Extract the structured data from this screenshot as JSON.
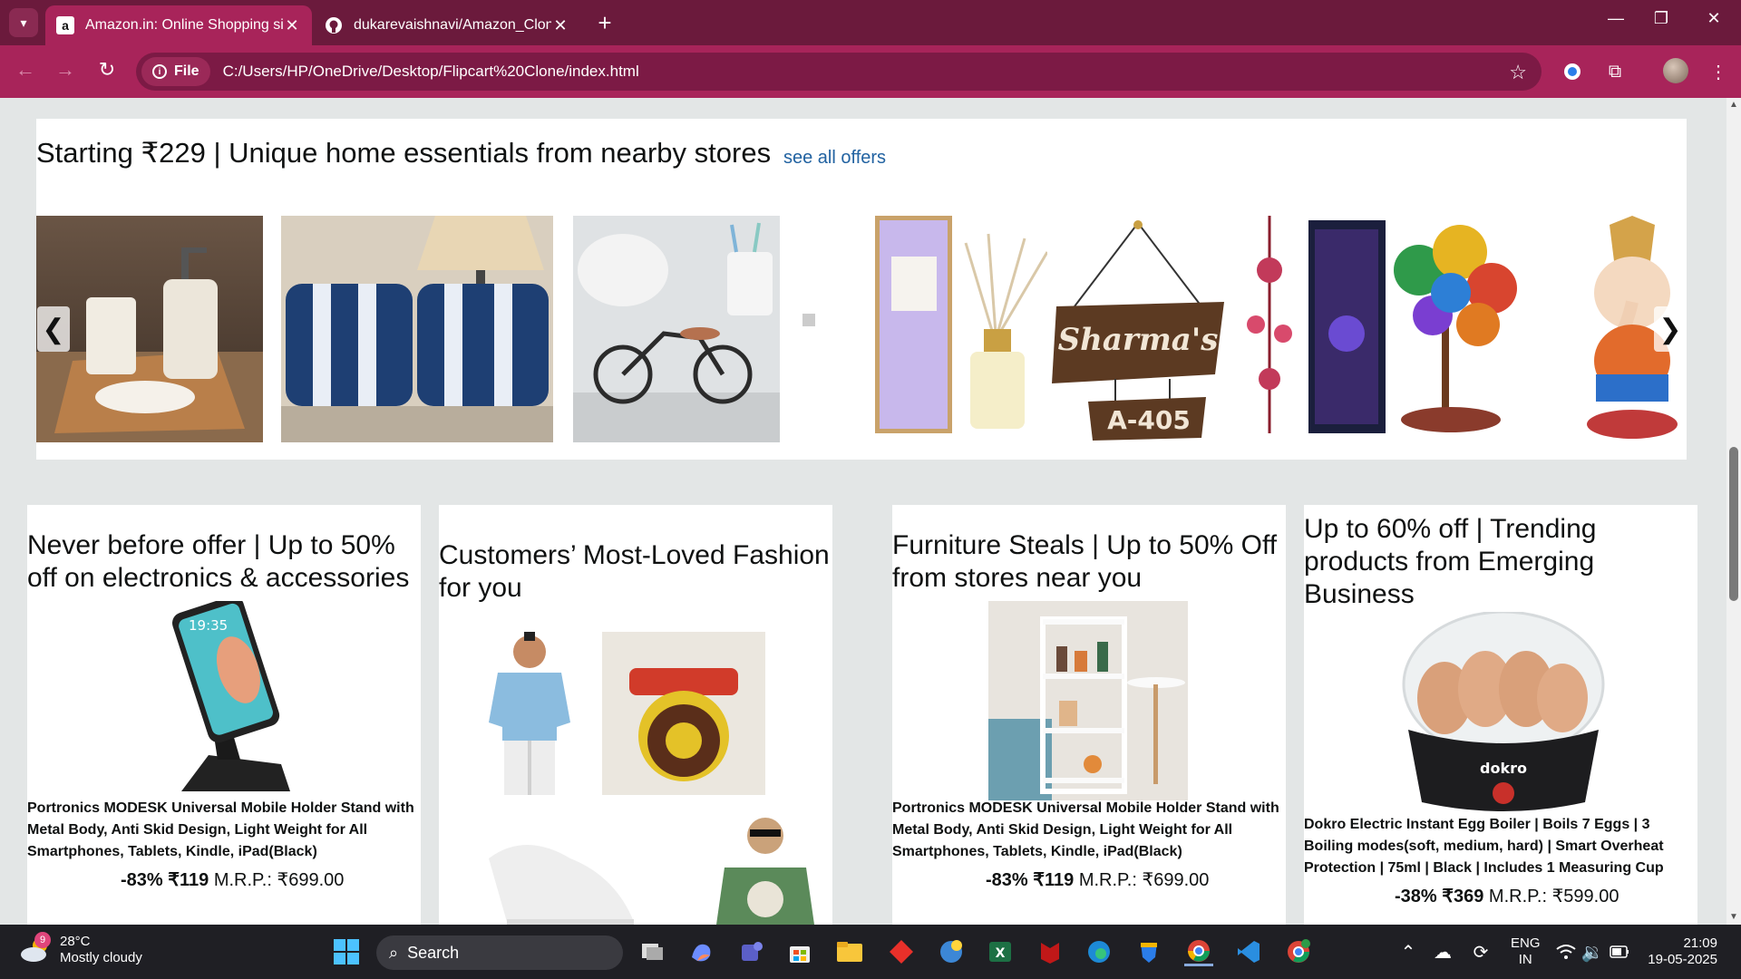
{
  "browser": {
    "tabs": [
      {
        "title": "Amazon.in: Online Shopping sit",
        "favicon": "a",
        "active": true
      },
      {
        "title": "dukarevaishnavi/Amazon_Clone",
        "favicon": "github-icon",
        "active": false
      }
    ],
    "address_chip": "File",
    "url": "C:/Users/HP/OneDrive/Desktop/Flipcart%20Clone/index.html"
  },
  "strip": {
    "title": "Starting ₹229 | Unique home essentials from nearby stores",
    "link": "see all offers",
    "prev": "❮",
    "next": "❯"
  },
  "cards": [
    {
      "title": "Never before offer | Up to 50% off on electronics & accessories",
      "desc": "Portronics MODESK Universal Mobile Holder Stand with Metal Body, Anti Skid Design, Light Weight for All Smartphones, Tablets, Kindle, iPad(Black)",
      "discount": "-83%",
      "price": "₹119",
      "mrp": "M.R.P.: ₹699.00",
      "phone_time": "19:35"
    },
    {
      "title": "Customers’ Most-Loved Fashion for you"
    },
    {
      "title": "Furniture Steals | Up to 50% Off from stores near you",
      "desc": "Portronics MODESK Universal Mobile Holder Stand with Metal Body, Anti Skid Design, Light Weight for All Smartphones, Tablets, Kindle, iPad(Black)",
      "discount": "-83%",
      "price": "₹119",
      "mrp": "M.R.P.: ₹699.00"
    },
    {
      "title": "Up to 60% off | Trending products from Emerging Business",
      "desc": "Dokro Electric Instant Egg Boiler | Boils 7 Eggs | 3 Boiling modes(soft, medium, hard) | Smart Overheat Protection | 75ml | Black | Includes 1 Measuring Cup",
      "discount": "-38%",
      "price": "₹369",
      "mrp": "M.R.P.: ₹599.00",
      "brand": "dokro"
    }
  ],
  "products": {
    "sign_name": "Sharma's",
    "sign_number": "A-405"
  },
  "taskbar": {
    "weather_temp": "28°C",
    "weather_desc": "Mostly cloudy",
    "weather_badge": "9",
    "search": "Search",
    "lang_top": "ENG",
    "lang_bottom": "IN",
    "time": "21:09",
    "date": "19-05-2025"
  },
  "colors": {
    "tabbar": "#6b1a3c",
    "toolbar": "#a8245a",
    "link": "#2162a1"
  }
}
